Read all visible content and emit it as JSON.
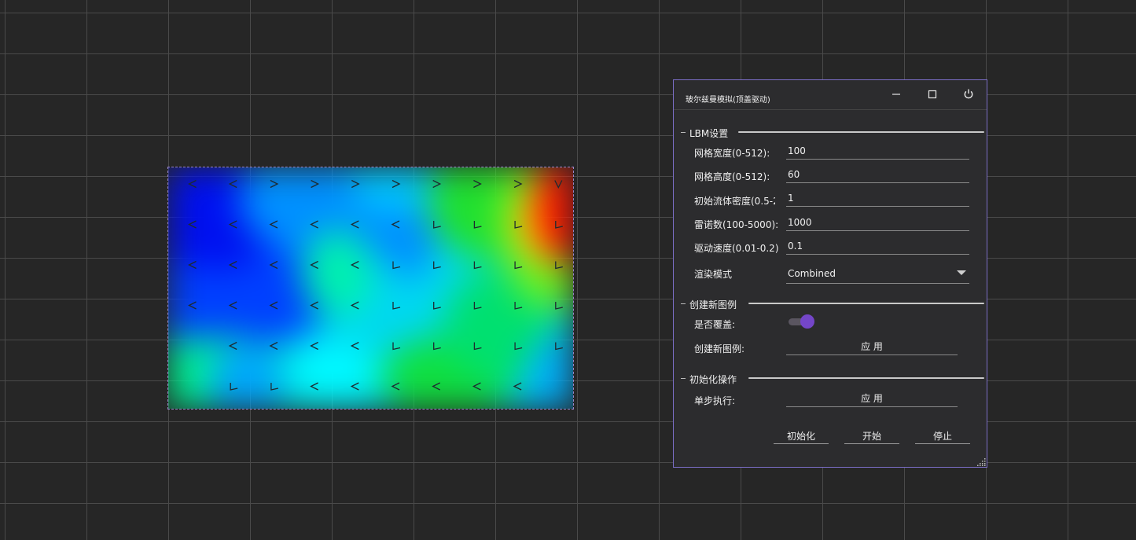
{
  "window": {
    "title": "玻尔兹曼模拟(顶盖驱动)"
  },
  "sections": {
    "lbm": "LBM设置",
    "create": "创建新图例",
    "init": "初始化操作"
  },
  "lbm_settings": {
    "grid_width_label": "网格宽度(0-512):",
    "grid_width_value": "100",
    "grid_height_label": "网格高度(0-512):",
    "grid_height_value": "60",
    "density_label": "初始流体密度(0.5-2",
    "density_value": "1",
    "reynolds_label": "雷诺数(100-5000):",
    "reynolds_value": "1000",
    "velocity_label": "驱动速度(0.01-0.2)",
    "velocity_value": "0.1",
    "render_mode_label": "渲染模式",
    "render_mode_value": "Combined"
  },
  "create_legend": {
    "overwrite_label": "是否覆盖:",
    "overwrite_on": true,
    "create_label": "创建新图例:",
    "apply_label": "应 用"
  },
  "init_ops": {
    "step_label": "单步执行:",
    "apply_label": "应 用"
  },
  "actions": {
    "init": "初始化",
    "start": "开始",
    "stop": "停止"
  },
  "icons": {
    "minimize": "minimize-icon",
    "maximize": "maximize-icon",
    "power": "power-icon",
    "resize": "resize-grip-icon"
  },
  "colors": {
    "accent": "#7446c8",
    "window_border": "#7b6ec6",
    "panel_bg": "#2c2c2e",
    "background": "#262626"
  },
  "flow_field": {
    "rows": [
      [
        "<",
        "<",
        ">",
        ">",
        ">",
        ">",
        ">",
        ">",
        ">",
        "v"
      ],
      [
        "<",
        "<",
        "<",
        "<",
        "<",
        "<",
        "L",
        "L",
        "L",
        "L"
      ],
      [
        "<",
        "<",
        "<",
        "<",
        "<",
        "L",
        "L",
        "L",
        "L",
        "L"
      ],
      [
        "<",
        "<",
        "<",
        "<",
        "<",
        "L",
        "L",
        "L",
        "L",
        "L"
      ],
      [
        "",
        "<",
        "<",
        "<",
        "<",
        "L",
        "L",
        "L",
        "L",
        "L"
      ],
      [
        "",
        "L",
        "L",
        "<",
        "<",
        "<",
        "<",
        "<",
        "<",
        ""
      ]
    ]
  }
}
